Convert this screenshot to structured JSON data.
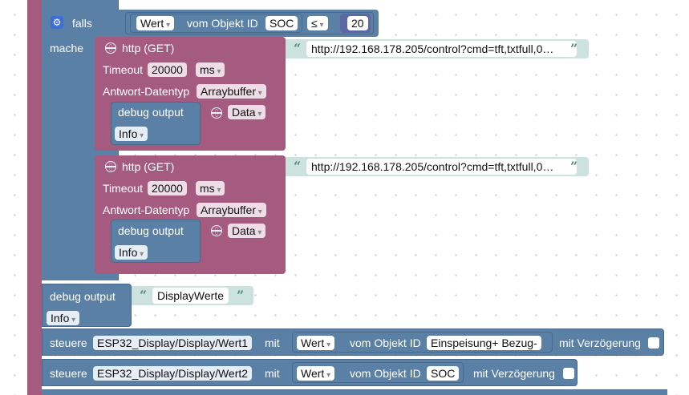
{
  "if_block": {
    "keyword": "falls",
    "condition": {
      "value_dropdown": "Wert",
      "of_object_label": "vom Objekt ID",
      "object_id": "SOC",
      "operator": "≤",
      "number": "20"
    }
  },
  "do_label": "mache",
  "http_blocks": [
    {
      "title": "http (GET)",
      "url": "http://192.168.178.205/control?cmd=tft,txtfull,0…",
      "timeout_label": "Timeout",
      "timeout_value": "20000",
      "timeout_unit": "ms",
      "type_label": "Antwort-Datentyp",
      "type_value": "Arraybuffer",
      "debug": {
        "label": "debug output",
        "data": "Data",
        "level": "Info"
      }
    },
    {
      "title": "http (GET)",
      "url": "http://192.168.178.205/control?cmd=tft,txtfull,0…",
      "timeout_label": "Timeout",
      "timeout_value": "20000",
      "timeout_unit": "ms",
      "type_label": "Antwort-Datentyp",
      "type_value": "Arraybuffer",
      "debug": {
        "label": "debug output",
        "data": "Data",
        "level": "Info"
      }
    }
  ],
  "debug_display": {
    "label": "debug output",
    "text": "DisplayWerte",
    "level": "Info"
  },
  "control_blocks": [
    {
      "keyword": "steuere",
      "target": "ESP32_Display/Display/Wert1",
      "with": "mit",
      "value_dropdown": "Wert",
      "of_object_label": "vom Objekt ID",
      "object_id": "Einspeisung+ Bezug-",
      "delay_label": "mit Verzögerung"
    },
    {
      "keyword": "steuere",
      "target": "ESP32_Display/Display/Wert2",
      "with": "mit",
      "value_dropdown": "Wert",
      "of_object_label": "vom Objekt ID",
      "object_id": "SOC",
      "delay_label": "mit Verzögerung"
    }
  ],
  "colors": {
    "logic_blue": "#5b80a5",
    "http_magenta": "#a55b80",
    "string_teal": "#cbe3dc",
    "outer_mauve": "#a55b80"
  }
}
